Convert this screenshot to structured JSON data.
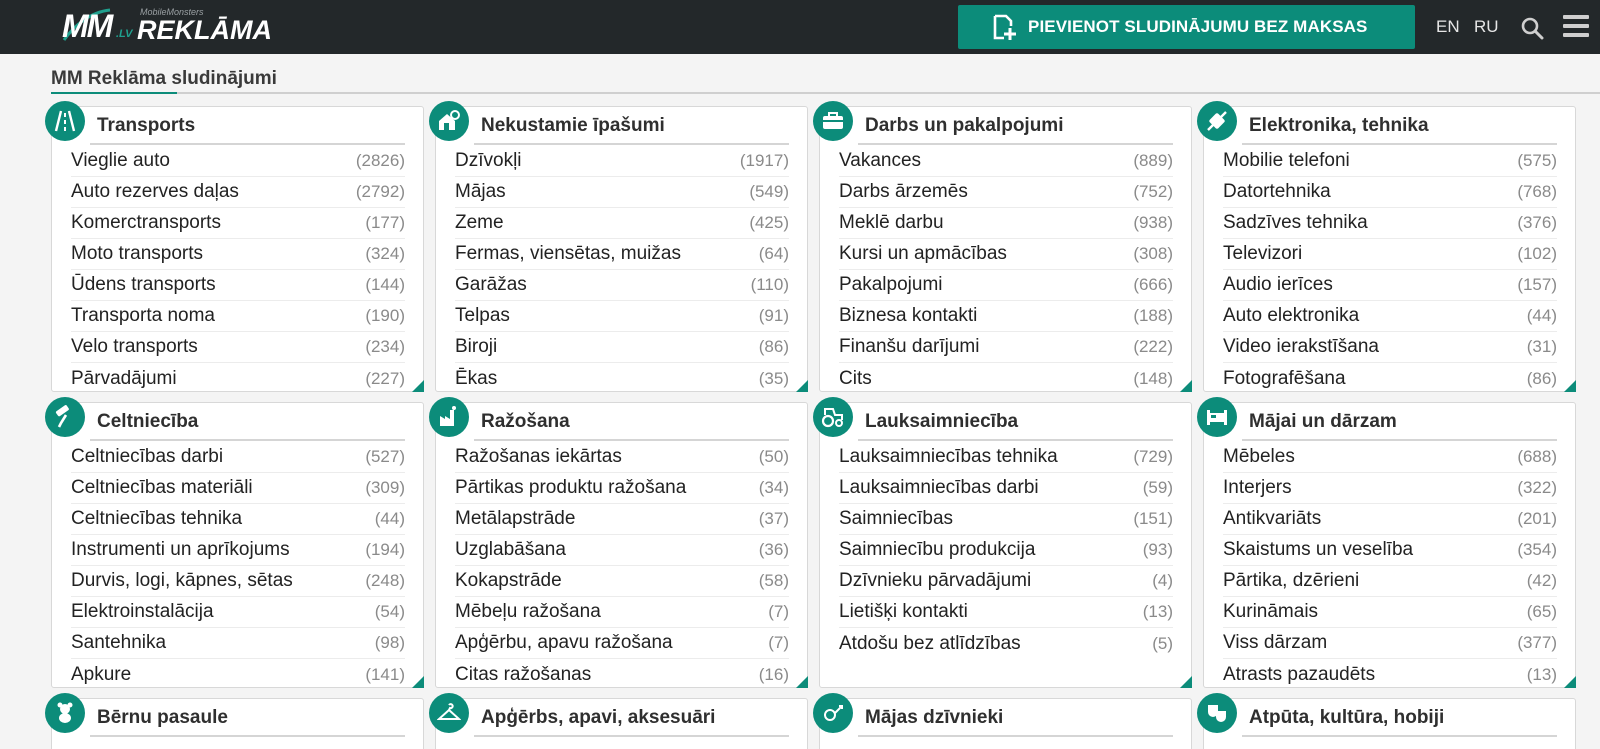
{
  "header": {
    "logo": {
      "mm": "MM",
      "lv": ".LV",
      "small": "MobileMonsters",
      "word": "REKLĀMA"
    },
    "add_button_label": "PIEVIENOT SLUDINĀJUMU BEZ MAKSAS",
    "lang_en": "EN",
    "lang_ru": "RU",
    "icons": [
      "add-listing-icon",
      "search-icon",
      "menu-icon"
    ]
  },
  "page_title": "MM Reklāma sludinājumi",
  "colors": {
    "accent": "#0c8c7a",
    "topbar": "#23282a",
    "count": "#8a8a8a"
  },
  "categories": [
    {
      "title": "Transports",
      "icon": "road-icon",
      "items": [
        {
          "name": "Vieglie auto",
          "count": "(2826)"
        },
        {
          "name": "Auto rezerves daļas",
          "count": "(2792)"
        },
        {
          "name": "Komerctransports",
          "count": "(177)"
        },
        {
          "name": "Moto transports",
          "count": "(324)"
        },
        {
          "name": "Ūdens transports",
          "count": "(144)"
        },
        {
          "name": "Transporta noma",
          "count": "(190)"
        },
        {
          "name": "Velo transports",
          "count": "(234)"
        },
        {
          "name": "Pārvadājumi",
          "count": "(227)"
        }
      ]
    },
    {
      "title": "Nekustamie īpašumi",
      "icon": "house-key-icon",
      "items": [
        {
          "name": "Dzīvokļi",
          "count": "(1917)"
        },
        {
          "name": "Mājas",
          "count": "(549)"
        },
        {
          "name": "Zeme",
          "count": "(425)"
        },
        {
          "name": "Fermas, viensētas, muižas",
          "count": "(64)"
        },
        {
          "name": "Garāžas",
          "count": "(110)"
        },
        {
          "name": "Telpas",
          "count": "(91)"
        },
        {
          "name": "Biroji",
          "count": "(86)"
        },
        {
          "name": "Ēkas",
          "count": "(35)"
        }
      ]
    },
    {
      "title": "Darbs un pakalpojumi",
      "icon": "briefcase-icon",
      "items": [
        {
          "name": "Vakances",
          "count": "(889)"
        },
        {
          "name": "Darbs ārzemēs",
          "count": "(752)"
        },
        {
          "name": "Meklē darbu",
          "count": "(938)"
        },
        {
          "name": "Kursi un apmācības",
          "count": "(308)"
        },
        {
          "name": "Pakalpojumi",
          "count": "(666)"
        },
        {
          "name": "Biznesa kontakti",
          "count": "(188)"
        },
        {
          "name": "Finanšu darījumi",
          "count": "(222)"
        },
        {
          "name": "Cits",
          "count": "(148)"
        }
      ]
    },
    {
      "title": "Elektronika, tehnika",
      "icon": "plug-icon",
      "items": [
        {
          "name": "Mobilie telefoni",
          "count": "(575)"
        },
        {
          "name": "Datortehnika",
          "count": "(768)"
        },
        {
          "name": "Sadzīves tehnika",
          "count": "(376)"
        },
        {
          "name": "Televizori",
          "count": "(102)"
        },
        {
          "name": "Audio ierīces",
          "count": "(157)"
        },
        {
          "name": "Auto elektronika",
          "count": "(44)"
        },
        {
          "name": "Video ierakstīšana",
          "count": "(31)"
        },
        {
          "name": "Fotografēšana",
          "count": "(86)"
        }
      ]
    },
    {
      "title": "Celtniecība",
      "icon": "paint-roller-icon",
      "items": [
        {
          "name": "Celtniecības darbi",
          "count": "(527)"
        },
        {
          "name": "Celtniecības materiāli",
          "count": "(309)"
        },
        {
          "name": "Celtniecības tehnika",
          "count": "(44)"
        },
        {
          "name": "Instrumenti un aprīkojums",
          "count": "(194)"
        },
        {
          "name": "Durvis, logi, kāpnes, sētas",
          "count": "(248)"
        },
        {
          "name": "Elektroinstalācija",
          "count": "(54)"
        },
        {
          "name": "Santehnika",
          "count": "(98)"
        },
        {
          "name": "Apkure",
          "count": "(141)"
        }
      ]
    },
    {
      "title": "Ražošana",
      "icon": "factory-icon",
      "items": [
        {
          "name": "Ražošanas iekārtas",
          "count": "(50)"
        },
        {
          "name": "Pārtikas produktu ražošana",
          "count": "(34)"
        },
        {
          "name": "Metālapstrāde",
          "count": "(37)"
        },
        {
          "name": "Uzglabāšana",
          "count": "(36)"
        },
        {
          "name": "Kokapstrāde",
          "count": "(58)"
        },
        {
          "name": "Mēbeļu ražošana",
          "count": "(7)"
        },
        {
          "name": "Apģērbu, apavu ražošana",
          "count": "(7)"
        },
        {
          "name": "Citas ražošanas",
          "count": "(16)"
        }
      ]
    },
    {
      "title": "Lauksaimniecība",
      "icon": "tractor-icon",
      "items": [
        {
          "name": "Lauksaimniecības tehnika",
          "count": "(729)"
        },
        {
          "name": "Lauksaimniecības darbi",
          "count": "(59)"
        },
        {
          "name": "Saimniecības",
          "count": "(151)"
        },
        {
          "name": "Saimniecību produkcija",
          "count": "(93)"
        },
        {
          "name": "Dzīvnieku pārvadājumi",
          "count": "(4)"
        },
        {
          "name": "Lietišķi kontakti",
          "count": "(13)"
        },
        {
          "name": "Atdošu bez atlīdzības",
          "count": "(5)"
        }
      ]
    },
    {
      "title": "Mājai un dārzam",
      "icon": "bed-icon",
      "items": [
        {
          "name": "Mēbeles",
          "count": "(688)"
        },
        {
          "name": "Interjers",
          "count": "(322)"
        },
        {
          "name": "Antikvariāts",
          "count": "(201)"
        },
        {
          "name": "Skaistums un veselība",
          "count": "(354)"
        },
        {
          "name": "Pārtika, dzērieni",
          "count": "(42)"
        },
        {
          "name": "Kurināmais",
          "count": "(65)"
        },
        {
          "name": "Viss dārzam",
          "count": "(377)"
        },
        {
          "name": "Atrasts pazaudēts",
          "count": "(13)"
        }
      ]
    },
    {
      "title": "Bērnu pasaule",
      "icon": "teddy-bear-icon",
      "items": []
    },
    {
      "title": "Apģērbs, apavi, aksesuāri",
      "icon": "hanger-icon",
      "items": []
    },
    {
      "title": "Mājas dzīvnieki",
      "icon": "pet-icon",
      "items": []
    },
    {
      "title": "Atpūta, kultūra, hobiji",
      "icon": "theater-masks-icon",
      "items": []
    }
  ]
}
